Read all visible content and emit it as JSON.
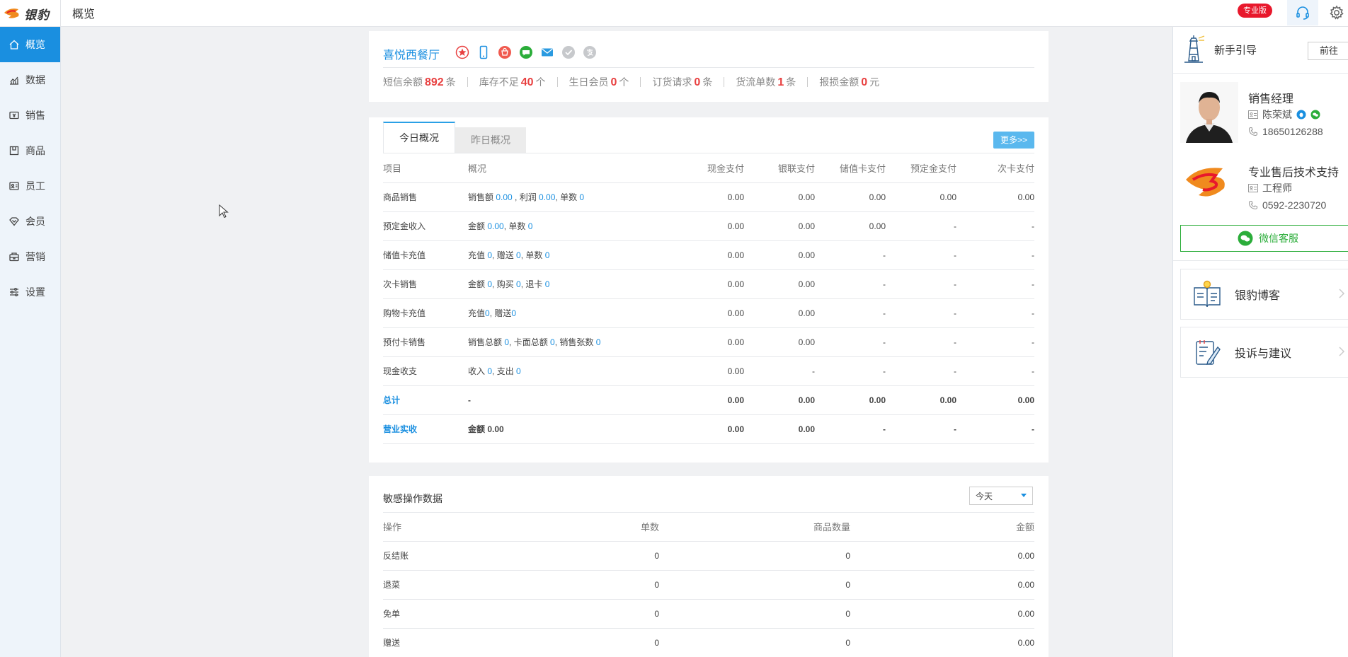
{
  "app": {
    "logo_text": "银豹",
    "page_title": "概览",
    "edition_badge": "专业版"
  },
  "topbar_icons": [
    "headset-icon",
    "gear-icon"
  ],
  "sidebar": {
    "items": [
      {
        "label": "概览",
        "icon": "home-icon",
        "active": true
      },
      {
        "label": "数据",
        "icon": "chart-icon"
      },
      {
        "label": "销售",
        "icon": "sales-icon"
      },
      {
        "label": "商品",
        "icon": "goods-icon"
      },
      {
        "label": "员工",
        "icon": "staff-icon"
      },
      {
        "label": "会员",
        "icon": "member-icon"
      },
      {
        "label": "营销",
        "icon": "marketing-icon"
      },
      {
        "label": "设置",
        "icon": "settings-icon"
      }
    ]
  },
  "shop": {
    "name": "喜悦西餐厅",
    "icons": [
      "star-badge-icon",
      "mobile-icon",
      "bag-icon",
      "message-icon",
      "mail-icon",
      "check-icon",
      "alipay-icon"
    ],
    "stats": [
      {
        "label": "短信余额",
        "value": "892",
        "unit": "条"
      },
      {
        "label": "库存不足",
        "value": "40",
        "unit": "个"
      },
      {
        "label": "生日会员",
        "value": "0",
        "unit": "个"
      },
      {
        "label": "订货请求",
        "value": "0",
        "unit": "条"
      },
      {
        "label": "货流单数",
        "value": "1",
        "unit": "条"
      },
      {
        "label": "报损金额",
        "value": "0",
        "unit": "元"
      }
    ]
  },
  "overview": {
    "tabs": [
      "今日概况",
      "昨日概况"
    ],
    "more_label": "更多>>",
    "columns": [
      "项目",
      "概况",
      "现金支付",
      "银联支付",
      "储值卡支付",
      "预定金支付",
      "次卡支付"
    ],
    "rows": [
      {
        "item": "商品销售",
        "summary": [
          [
            "销售额 ",
            ""
          ],
          [
            "0.00",
            "n"
          ],
          [
            " , 利润 ",
            ""
          ],
          [
            "0.00",
            "n"
          ],
          [
            ", 单数 ",
            ""
          ],
          [
            "0",
            "n"
          ]
        ],
        "cash": "0.00",
        "union": "0.00",
        "stored": "0.00",
        "deposit": "0.00",
        "times": "0.00"
      },
      {
        "item": "预定金收入",
        "summary": [
          [
            "金额 ",
            ""
          ],
          [
            "0.00",
            "n"
          ],
          [
            ", 单数 ",
            ""
          ],
          [
            "0",
            "n"
          ]
        ],
        "cash": "0.00",
        "union": "0.00",
        "stored": "0.00",
        "deposit": "-",
        "times": "-"
      },
      {
        "item": "储值卡充值",
        "summary": [
          [
            "充值 ",
            ""
          ],
          [
            "0",
            "n"
          ],
          [
            ", 赠送 ",
            ""
          ],
          [
            "0",
            "n"
          ],
          [
            ", 单数 ",
            ""
          ],
          [
            "0",
            "n"
          ]
        ],
        "cash": "0.00",
        "union": "0.00",
        "stored": "-",
        "deposit": "-",
        "times": "-"
      },
      {
        "item": "次卡销售",
        "summary": [
          [
            "金额 ",
            ""
          ],
          [
            "0",
            "n"
          ],
          [
            ", 购买 ",
            ""
          ],
          [
            "0",
            "n"
          ],
          [
            ", 退卡 ",
            ""
          ],
          [
            "0",
            "n"
          ]
        ],
        "cash": "0.00",
        "union": "0.00",
        "stored": "-",
        "deposit": "-",
        "times": "-"
      },
      {
        "item": "购物卡充值",
        "summary": [
          [
            "充值",
            ""
          ],
          [
            "0",
            "n"
          ],
          [
            ", 赠送",
            ""
          ],
          [
            "0",
            "n"
          ]
        ],
        "cash": "0.00",
        "union": "0.00",
        "stored": "-",
        "deposit": "-",
        "times": "-"
      },
      {
        "item": "预付卡销售",
        "summary": [
          [
            "销售总额 ",
            ""
          ],
          [
            "0",
            "n"
          ],
          [
            ", 卡面总额 ",
            ""
          ],
          [
            "0",
            "n"
          ],
          [
            ", 销售张数 ",
            ""
          ],
          [
            "0",
            "n"
          ]
        ],
        "cash": "0.00",
        "union": "0.00",
        "stored": "-",
        "deposit": "-",
        "times": "-"
      },
      {
        "item": "现金收支",
        "summary": [
          [
            "收入 ",
            ""
          ],
          [
            "0",
            "n"
          ],
          [
            ", 支出 ",
            ""
          ],
          [
            "0",
            "n"
          ]
        ],
        "cash": "0.00",
        "union": "-",
        "stored": "-",
        "deposit": "-",
        "times": "-"
      },
      {
        "item": "总计",
        "bold": true,
        "summary": [
          [
            "-",
            ""
          ]
        ],
        "cash": "0.00",
        "union": "0.00",
        "stored": "0.00",
        "deposit": "0.00",
        "times": "0.00"
      },
      {
        "item": "营业实收",
        "bold": true,
        "summary": [
          [
            "金额 0.00",
            ""
          ]
        ],
        "cash": "0.00",
        "union": "0.00",
        "stored": "-",
        "deposit": "-",
        "times": "-"
      }
    ]
  },
  "sensitive": {
    "title": "敏感操作数据",
    "select_value": "今天",
    "columns": [
      "操作",
      "单数",
      "商品数量",
      "金额"
    ],
    "rows": [
      {
        "op": "反结账",
        "count": "0",
        "count_link": true,
        "qty": "0",
        "amount": "0.00"
      },
      {
        "op": "退菜",
        "count": "0",
        "count_link": true,
        "qty": "0",
        "amount": "0.00"
      },
      {
        "op": "免单",
        "count": "0",
        "count_link": false,
        "qty": "0",
        "amount": "0.00"
      },
      {
        "op": "赠送",
        "count": "0",
        "count_link": false,
        "qty": "0",
        "amount": "0.00"
      }
    ]
  },
  "right_panel": {
    "guide_label": "新手引导",
    "guide_button": "前往",
    "sales_manager": {
      "title": "销售经理",
      "name": "陈荣斌",
      "phone": "18650126288"
    },
    "support": {
      "title": "专业售后技术支持",
      "role": "工程师",
      "phone": "0592-2230720"
    },
    "wechat_label": "微信客服",
    "cards": [
      {
        "label": "银豹博客",
        "icon": "blog-book-icon"
      },
      {
        "label": "投诉与建议",
        "icon": "feedback-note-icon"
      }
    ]
  }
}
